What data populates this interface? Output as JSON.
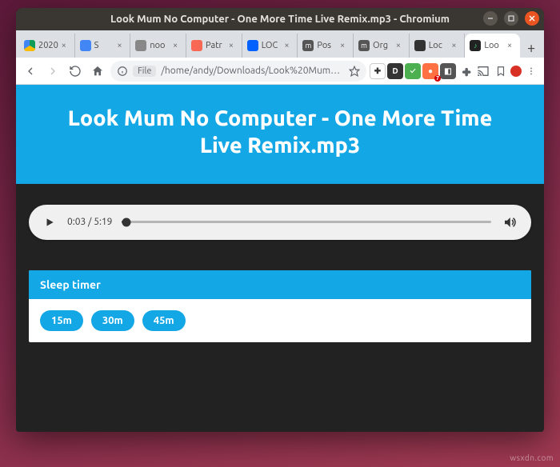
{
  "window": {
    "title": "Look Mum No Computer - One More Time Live Remix.mp3 - Chromium"
  },
  "tabs": [
    {
      "label": "2020",
      "fav_class": "gdrive"
    },
    {
      "label": "S",
      "fav_class": "docs"
    },
    {
      "label": "noo",
      "fav_class": "generic"
    },
    {
      "label": "Patr",
      "fav_class": "patreon"
    },
    {
      "label": "LOC",
      "fav_class": "dropbox"
    },
    {
      "label": "Pos",
      "fav_class": "m"
    },
    {
      "label": "Org",
      "fav_class": "m"
    },
    {
      "label": "Loc",
      "fav_class": "dark"
    },
    {
      "label": "Loo",
      "fav_class": "note",
      "active": true
    }
  ],
  "omnibox": {
    "scheme_chip": "File",
    "url": "/home/andy/Downloads/Look%20Mum%20No%2…"
  },
  "page": {
    "title_line1": "Look Mum No Computer - One More Time",
    "title_line2": "Live Remix.mp3",
    "player": {
      "current": "0:03",
      "sep": " / ",
      "duration": "5:19"
    },
    "sleep_timer": {
      "heading": "Sleep timer",
      "options": [
        "15m",
        "30m",
        "45m"
      ]
    }
  },
  "watermark": "wsxdn.com"
}
